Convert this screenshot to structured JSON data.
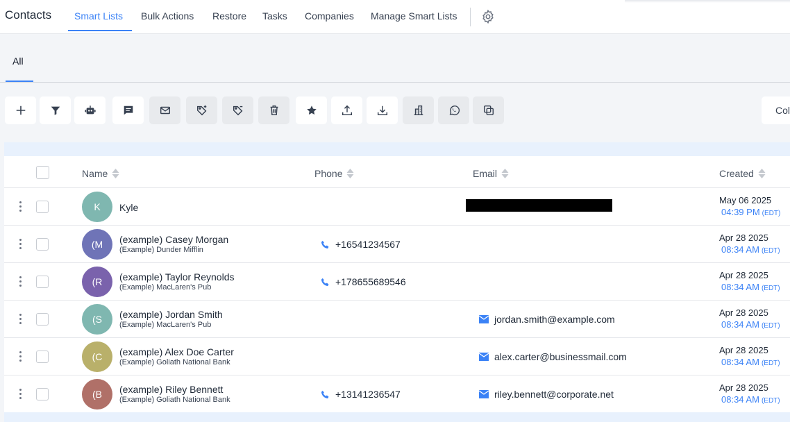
{
  "nav": {
    "brand": "Contacts",
    "tabs": [
      "Smart Lists",
      "Bulk Actions",
      "Restore",
      "Tasks",
      "Companies",
      "Manage Smart Lists"
    ],
    "active_tab": "Smart Lists"
  },
  "subtab": {
    "label": "All"
  },
  "toolbar": {
    "buttons": [
      {
        "icon": "plus-icon"
      },
      {
        "icon": "filter-icon"
      },
      {
        "icon": "robot-icon"
      },
      {
        "icon": "message-icon"
      },
      {
        "icon": "email-icon"
      },
      {
        "icon": "add-tag-icon"
      },
      {
        "icon": "remove-tag-icon"
      },
      {
        "icon": "trash-icon"
      },
      {
        "icon": "star-icon"
      },
      {
        "icon": "upload-icon"
      },
      {
        "icon": "download-icon"
      },
      {
        "icon": "building-icon"
      },
      {
        "icon": "whatsapp-icon"
      },
      {
        "icon": "merge-icon"
      }
    ],
    "columns_label": "Col"
  },
  "table": {
    "headers": {
      "name": "Name",
      "phone": "Phone",
      "email": "Email",
      "created": "Created"
    },
    "rows": [
      {
        "initial": "K",
        "avatar_color": "#7fb7b0",
        "name": "Kyle",
        "company": "",
        "phone": "",
        "email": "",
        "email_redacted": true,
        "date": "May 06 2025",
        "time": "04:39 PM",
        "tz": "(EDT)"
      },
      {
        "initial": "(M",
        "avatar_color": "#6f74b7",
        "name": "(example) Casey Morgan",
        "company": "(Example) Dunder Mifflin",
        "phone": "+16541234567",
        "email": "",
        "email_redacted": false,
        "date": "Apr 28 2025",
        "time": "08:34 AM",
        "tz": "(EDT)"
      },
      {
        "initial": "(R",
        "avatar_color": "#7a62ac",
        "name": "(example) Taylor Reynolds",
        "company": "(Example) MacLaren's Pub",
        "phone": "+178655689546",
        "email": "",
        "email_redacted": false,
        "date": "Apr 28 2025",
        "time": "08:34 AM",
        "tz": "(EDT)"
      },
      {
        "initial": "(S",
        "avatar_color": "#7fb7b0",
        "name": "(example) Jordan Smith",
        "company": "(Example) MacLaren's Pub",
        "phone": "",
        "email": "jordan.smith@example.com",
        "email_redacted": false,
        "date": "Apr 28 2025",
        "time": "08:34 AM",
        "tz": "(EDT)"
      },
      {
        "initial": "(C",
        "avatar_color": "#b9b06a",
        "name": "(example) Alex Doe Carter",
        "company": "(Example) Goliath National Bank",
        "phone": "",
        "email": "alex.carter@businessmail.com",
        "email_redacted": false,
        "date": "Apr 28 2025",
        "time": "08:34 AM",
        "tz": "(EDT)"
      },
      {
        "initial": "(B",
        "avatar_color": "#b07068",
        "name": "(example) Riley Bennett",
        "company": "(Example) Goliath National Bank",
        "phone": "+13141236547",
        "email": "riley.bennett@corporate.net",
        "email_redacted": false,
        "date": "Apr 28 2025",
        "time": "08:34 AM",
        "tz": "(EDT)"
      }
    ]
  },
  "colors": {
    "accent": "#3b82f6"
  }
}
